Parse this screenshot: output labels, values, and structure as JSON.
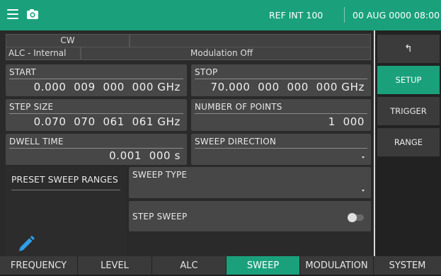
{
  "header": {
    "reference": "REF INT 100",
    "datetime": "00 AUG 0000 08:00"
  },
  "status": {
    "mode": "CW",
    "alc": "ALC - Internal",
    "modulation": "Modulation Off"
  },
  "fields": {
    "start": {
      "label": "START",
      "value": "0.000  009  000  000 GHz"
    },
    "stop": {
      "label": "STOP",
      "value": "70.000  000  000  000 GHz"
    },
    "step_size": {
      "label": "STEP SIZE",
      "value": "0.070  070  061  061 GHz"
    },
    "num_points": {
      "label": "NUMBER OF POINTS",
      "value": "1  000"
    },
    "dwell_time": {
      "label": "DWELL TIME",
      "value": "0.001  000 s"
    },
    "sweep_direction": {
      "label": "SWEEP DIRECTION",
      "value": ""
    },
    "sweep_type": {
      "label": "SWEEP TYPE",
      "value": ""
    },
    "step_sweep": {
      "label": "STEP SWEEP",
      "enabled": false
    }
  },
  "preset": {
    "label": "PRESET SWEEP RANGES",
    "icon": "pencil-icon"
  },
  "side_menu": {
    "back_icon": "↰",
    "items": [
      "SETUP",
      "TRIGGER",
      "RANGE"
    ],
    "active": "SETUP"
  },
  "tabs": {
    "items": [
      "FREQUENCY",
      "LEVEL",
      "ALC",
      "SWEEP",
      "MODULATION",
      "SYSTEM"
    ],
    "active": "SWEEP"
  },
  "colors": {
    "accent": "#1aa17c",
    "panel": "#474747",
    "background": "#2a2a2a"
  }
}
